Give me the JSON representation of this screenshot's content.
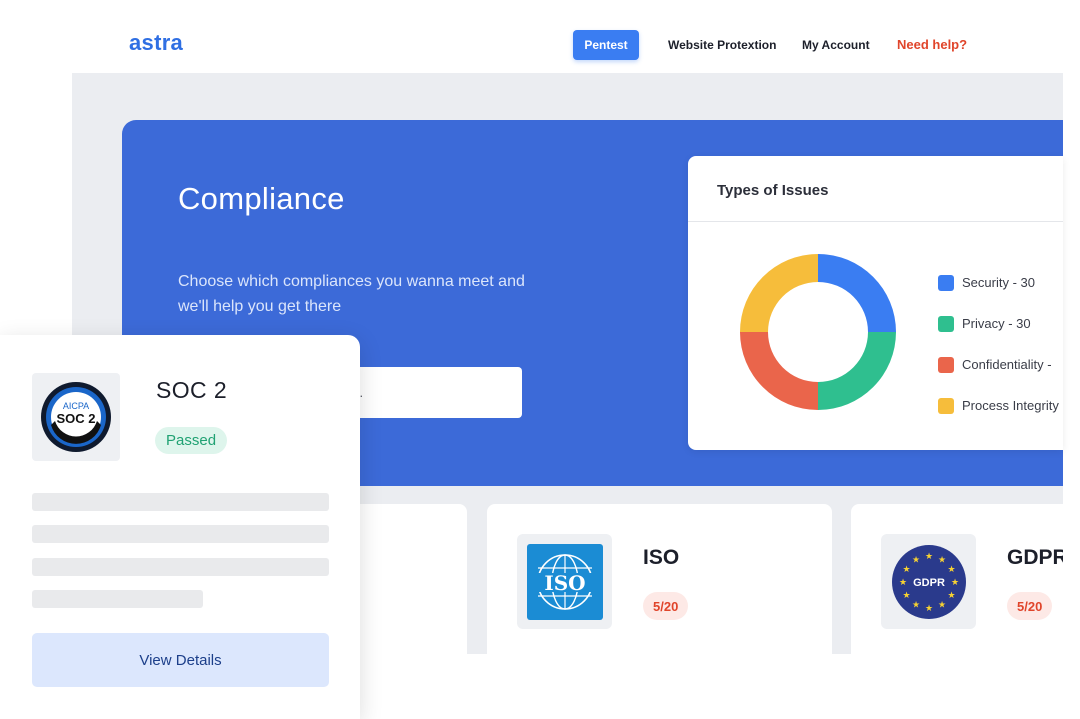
{
  "nav": {
    "logo": "astra",
    "items": [
      {
        "label": "Pentest"
      },
      {
        "label": "Website Protextion"
      },
      {
        "label": "My Account"
      },
      {
        "label": "Need help?"
      }
    ],
    "accent": "#3a7df2",
    "help_color": "#e0452b"
  },
  "hero": {
    "title": "Compliance",
    "description": "Choose which compliances you wanna meet and we'll help you get there",
    "search_visible_text": "ces..."
  },
  "issues": {
    "title": "Types of Issues",
    "legend": [
      {
        "label": "Security - 30",
        "color": "#3a7df2"
      },
      {
        "label": "Privacy - 30",
        "color": "#2fbf8f"
      },
      {
        "label": "Confidentiality -",
        "color": "#ea654b"
      },
      {
        "label": "Process Integrity",
        "color": "#f6bd3b"
      }
    ]
  },
  "chart_data": {
    "type": "pie",
    "labels": [
      "Security",
      "Privacy",
      "Confidentiality",
      "Process Integrity"
    ],
    "values": [
      30,
      30,
      30,
      30
    ],
    "colors": [
      "#3a7df2",
      "#2fbf8f",
      "#ea654b",
      "#f6bd3b"
    ],
    "donut": true
  },
  "cards": [
    {
      "name": "ISO",
      "score": "5/20",
      "logo_text": "ISO",
      "icon": "iso-globe-icon"
    },
    {
      "name": "GDPR",
      "score": "5/20",
      "logo_text": "GDPR",
      "icon": "eu-stars-icon"
    }
  ],
  "soc": {
    "name": "SOC 2",
    "status": "Passed",
    "logo_text_top": "AICPA",
    "logo_text_main": "SOC 2",
    "button": "View Details",
    "status_color": "#20a273"
  }
}
